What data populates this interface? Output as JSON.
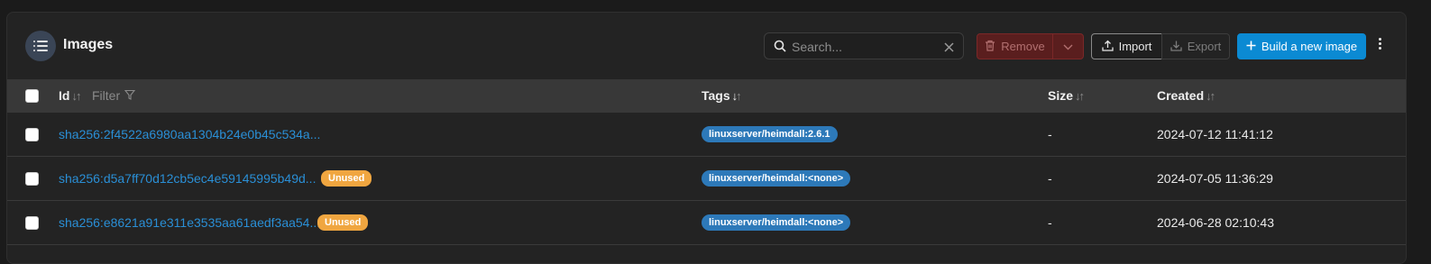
{
  "header": {
    "title": "Images",
    "title_icon": "list-icon"
  },
  "search": {
    "placeholder": "Search...",
    "value": ""
  },
  "toolbar": {
    "remove_label": "Remove",
    "import_label": "Import",
    "export_label": "Export",
    "build_label": "Build a new image"
  },
  "table": {
    "columns": {
      "id": "Id",
      "filter": "Filter",
      "tags": "Tags",
      "size": "Size",
      "created": "Created"
    },
    "sort": {
      "id_arrows": "↓↑",
      "tags_down": "↓",
      "tags_up": "↑",
      "size_arrows": "↓↑",
      "created_arrows": "↓↑"
    },
    "rows": [
      {
        "id": "sha256:2f4522a6980aa1304b24e0b45c534a...",
        "unused": "",
        "tag": "linuxserver/heimdall:2.6.1",
        "size": "-",
        "created": "2024-07-12 11:41:12"
      },
      {
        "id": "sha256:d5a7ff70d12cb5ec4e59145995b49d...",
        "unused": "Unused",
        "tag": "linuxserver/heimdall:<none>",
        "size": "-",
        "created": "2024-07-05 11:36:29"
      },
      {
        "id": "sha256:e8621a91e311e3535aa61aedf3aa54...",
        "unused": "Unused",
        "tag": "linuxserver/heimdall:<none>",
        "size": "-",
        "created": "2024-06-28 02:10:43"
      }
    ]
  },
  "colors": {
    "accent": "#0b8ad3",
    "danger": "#5a1e1e",
    "unused_badge": "#f0a640",
    "tag_badge": "#2d79b9",
    "link": "#2a8fd6"
  }
}
